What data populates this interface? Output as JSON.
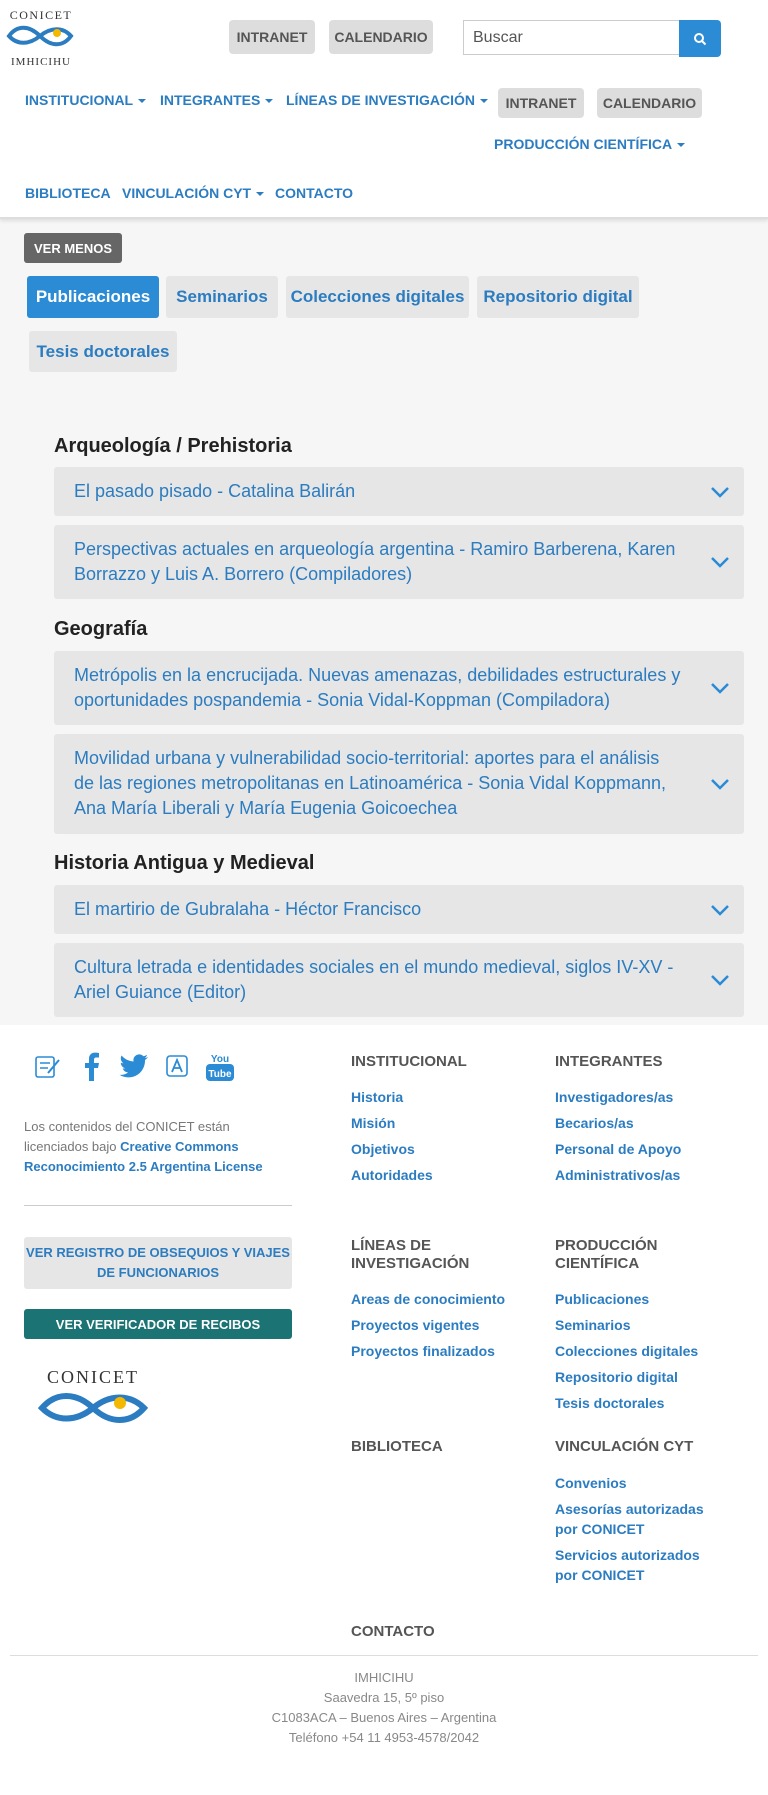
{
  "brand": {
    "logo_top": "CONICET",
    "logo_bottom": "IMHICIHU"
  },
  "header": {
    "intranet_label": "INTRANET",
    "calendario_label": "CALENDARIO",
    "search_placeholder": "Buscar"
  },
  "nav": {
    "institucional": "INSTITUCIONAL",
    "integrantes": "INTEGRANTES",
    "lineas": "LÍNEAS DE INVESTIGACIÓN",
    "intranet": "INTRANET",
    "calendario": "CALENDARIO",
    "produccion": "PRODUCCIÓN CIENTÍFICA",
    "biblioteca": "BIBLIOTECA",
    "vinculacion": "VINCULACIÓN CYT",
    "contacto": "CONTACTO"
  },
  "ver_menos_label": "VER MENOS",
  "tabs": [
    "Publicaciones",
    "Seminarios",
    "Colecciones digitales",
    "Repositorio digital",
    "Tesis doctorales"
  ],
  "sections": [
    {
      "title": "Arqueología / Prehistoria",
      "items": [
        "El pasado pisado - Catalina Balirán",
        "Perspectivas actuales en arqueología argentina - Ramiro Barberena, Karen Borrazzo y Luis A. Borrero (Compiladores)"
      ]
    },
    {
      "title": "Geografía",
      "items": [
        "Metrópolis en la encrucijada. Nuevas amenazas, debilidades estructurales y oportunidades pospandemia - Sonia Vidal-Koppman (Compiladora)",
        "Movilidad urbana y vulnerabilidad socio-territorial: aportes para el análisis de las regiones metropolitanas en Latinoamérica - Sonia Vidal Koppmann, Ana María Liberali y María Eugenia Goicoechea"
      ]
    },
    {
      "title": "Historia Antigua y Medieval",
      "items": [
        "El martirio de Gubralaha -  Héctor Francisco",
        "Cultura letrada e identidades sociales en el mundo medieval, siglos IV-XV - Ariel Guiance (Editor)"
      ]
    }
  ],
  "footer": {
    "license_text": "Los contenidos del CONICET están licenciados bajo ",
    "license_link": "Creative Commons Reconocimiento 2.5 Argentina License",
    "btn_registro": "VER REGISTRO DE OBSEQUIOS Y VIAJES DE FUNCIONARIOS",
    "btn_verificador": "VER VERIFICADOR DE RECIBOS",
    "logo_text": "CONICET",
    "institucional": {
      "title": "INSTITUCIONAL",
      "links": [
        "Historia",
        "Misión",
        "Objetivos",
        "Autoridades"
      ]
    },
    "integrantes": {
      "title": "INTEGRANTES",
      "links": [
        "Investigadores/as",
        "Becarios/as",
        "Personal de Apoyo",
        "Administrativos/as"
      ]
    },
    "lineas": {
      "title": "LÍNEAS DE INVESTIGACIÓN",
      "links": [
        "Areas de conocimiento",
        "Proyectos vigentes",
        "Proyectos finalizados"
      ]
    },
    "produccion": {
      "title": "PRODUCCIÓN CIENTÍFICA",
      "links": [
        "Publicaciones",
        "Seminarios",
        "Colecciones digitales",
        "Repositorio digital",
        "Tesis doctorales"
      ]
    },
    "biblioteca": {
      "title": "BIBLIOTECA"
    },
    "vinculacion": {
      "title": "VINCULACIÓN CYT",
      "links": [
        "Convenios",
        "Asesorías autorizadas por CONICET",
        "Servicios autorizados por CONICET"
      ]
    },
    "contacto": {
      "title": "CONTACTO"
    },
    "address": [
      "IMHICIHU",
      "Saavedra 15, 5º piso",
      "C1083ACA – Buenos Aires – Argentina",
      "Teléfono +54 11 4953-4578/2042"
    ]
  },
  "colors": {
    "accent": "#2b8bd5",
    "link": "#2b7cc0",
    "teal": "#1b7373"
  }
}
